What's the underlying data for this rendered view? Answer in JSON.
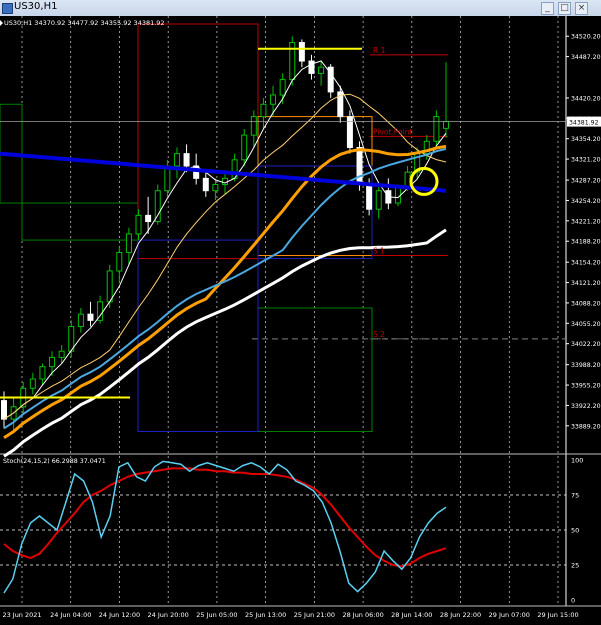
{
  "window": {
    "title": "US30,H1",
    "minimize_icon": "minimize-icon",
    "maximize_icon": "maximize-icon",
    "close_icon": "close-icon"
  },
  "chart_data": [
    {
      "type": "candlestick",
      "symbol_header": "US30,H1  34370.92 34477.92 34355.92 34381.92",
      "ylim": [
        33850,
        34540
      ],
      "y_ticks": [
        "34520.20",
        "34487.20",
        "34420.20",
        "34387.20",
        "34354.20",
        "34321.20",
        "34287.20",
        "34254.20",
        "34221.20",
        "34188.20",
        "34154.20",
        "34121.20",
        "34088.20",
        "34055.20",
        "34022.20",
        "33988.20",
        "33955.20",
        "33922.20",
        "33889.20"
      ],
      "current_price_label": "34381.92",
      "annotations": [
        "R 1",
        "Pivot Point",
        "S 1",
        "S 2"
      ],
      "x_ticks": [
        "23 Jun 2021",
        "24 Jun 04:00",
        "24 Jun 12:00",
        "24 Jun 20:00",
        "25 Jun 05:00",
        "25 Jun 13:00",
        "25 Jun 21:00",
        "28 Jun 06:00",
        "28 Jun 14:00",
        "28 Jun 22:00",
        "29 Jun 07:00",
        "29 Jun 15:00"
      ],
      "colors": {
        "bull": "#00c000",
        "bear": "#ffffff",
        "ma_blue": "#0000dd",
        "ma_light_blue": "#4aa8e0",
        "ma_orange": "#ffa000",
        "ma_white": "#ffffff",
        "highlight_circle": "#ffff00"
      },
      "candles": [
        [
          33930,
          33945,
          33885,
          33900
        ],
        [
          33900,
          33935,
          33880,
          33920
        ],
        [
          33920,
          33960,
          33910,
          33950
        ],
        [
          33950,
          33975,
          33940,
          33965
        ],
        [
          33965,
          33990,
          33955,
          33985
        ],
        [
          33985,
          34010,
          33970,
          34000
        ],
        [
          34000,
          34020,
          33990,
          34010
        ],
        [
          34010,
          34060,
          34000,
          34050
        ],
        [
          34050,
          34080,
          34040,
          34070
        ],
        [
          34070,
          34090,
          34050,
          34060
        ],
        [
          34060,
          34100,
          34055,
          34090
        ],
        [
          34090,
          34150,
          34080,
          34140
        ],
        [
          34140,
          34180,
          34120,
          34170
        ],
        [
          34170,
          34210,
          34150,
          34200
        ],
        [
          34200,
          34240,
          34190,
          34230
        ],
        [
          34230,
          34260,
          34200,
          34220
        ],
        [
          34220,
          34280,
          34215,
          34270
        ],
        [
          34270,
          34320,
          34260,
          34310
        ],
        [
          34310,
          34340,
          34290,
          34330
        ],
        [
          34330,
          34345,
          34300,
          34310
        ],
        [
          34310,
          34330,
          34280,
          34290
        ],
        [
          34290,
          34300,
          34260,
          34270
        ],
        [
          34270,
          34290,
          34255,
          34280
        ],
        [
          34280,
          34300,
          34265,
          34290
        ],
        [
          34290,
          34330,
          34285,
          34320
        ],
        [
          34320,
          34370,
          34310,
          34360
        ],
        [
          34360,
          34400,
          34340,
          34390
        ],
        [
          34390,
          34420,
          34370,
          34410
        ],
        [
          34410,
          34440,
          34390,
          34425
        ],
        [
          34425,
          34460,
          34410,
          34450
        ],
        [
          34450,
          34520,
          34440,
          34510
        ],
        [
          34510,
          34515,
          34470,
          34480
        ],
        [
          34480,
          34490,
          34450,
          34460
        ],
        [
          34460,
          34480,
          34440,
          34470
        ],
        [
          34470,
          34475,
          34420,
          34430
        ],
        [
          34430,
          34440,
          34380,
          34390
        ],
        [
          34390,
          34400,
          34330,
          34340
        ],
        [
          34340,
          34350,
          34270,
          34280
        ],
        [
          34280,
          34290,
          34230,
          34240
        ],
        [
          34240,
          34280,
          34225,
          34270
        ],
        [
          34270,
          34290,
          34240,
          34250
        ],
        [
          34250,
          34280,
          34245,
          34275
        ],
        [
          34275,
          34310,
          34270,
          34300
        ],
        [
          34300,
          34340,
          34290,
          34330
        ],
        [
          34330,
          34360,
          34320,
          34350
        ],
        [
          34350,
          34400,
          34340,
          34390
        ],
        [
          34370.92,
          34477.92,
          34355.92,
          34381.92
        ]
      ],
      "yellow_levels": [
        {
          "value": 33935,
          "x_start": "23 Jun 2021",
          "x_end": "24 Jun 20:00"
        },
        {
          "value": 34500,
          "x_start": "25 Jun 21:00",
          "x_end": "28 Jun 14:00"
        }
      ],
      "gray_dashed_level": 34030,
      "pivot_levels": [
        {
          "label": "R 1",
          "value": 34490
        },
        {
          "label": "Pivot Point",
          "value": 34358
        },
        {
          "label": "S 1",
          "value": 34165
        },
        {
          "label": "S 2",
          "value": 34030
        }
      ]
    },
    {
      "type": "line",
      "indicator_label": "Stoch(24,15,2) 66.2988 37.0471",
      "ylim": [
        0,
        100
      ],
      "y_ticks": [
        "100",
        "75",
        "50",
        "25",
        "0"
      ],
      "levels": [
        75,
        50,
        25
      ],
      "series": [
        {
          "values": [
            5,
            15,
            40,
            55,
            60,
            55,
            50,
            70,
            90,
            85,
            70,
            45,
            60,
            95,
            98,
            88,
            85,
            95,
            99,
            98,
            97,
            92,
            96,
            98,
            96,
            94,
            92,
            96,
            98,
            95,
            90,
            97,
            93,
            85,
            82,
            78,
            70,
            55,
            35,
            12,
            6,
            12,
            20,
            35,
            28,
            22,
            30,
            45,
            55,
            62,
            66.3
          ]
        },
        {
          "values": [
            40,
            35,
            32,
            30,
            33,
            40,
            48,
            55,
            62,
            70,
            75,
            78,
            82,
            85,
            88,
            90,
            91,
            92,
            93,
            94,
            94,
            94,
            93,
            93,
            92,
            92,
            91,
            91,
            90,
            90,
            90,
            89,
            88,
            86,
            83,
            80,
            75,
            68,
            60,
            52,
            45,
            38,
            32,
            28,
            25,
            24,
            26,
            30,
            33,
            35,
            37.0
          ]
        }
      ]
    }
  ]
}
